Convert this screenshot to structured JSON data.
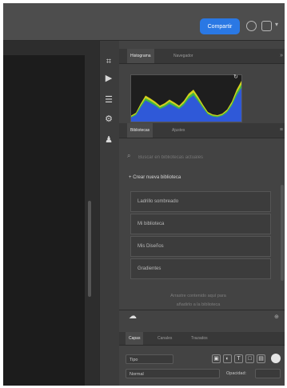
{
  "topbar": {
    "share_label": "Compartir"
  },
  "histogram_panel": {
    "tabs": [
      "Histograma",
      "Navegador"
    ],
    "collapse_glyph": "»",
    "icon": "refresh-icon",
    "levels": [
      0.05,
      0.12,
      0.35,
      0.55,
      0.48,
      0.4,
      0.3,
      0.36,
      0.45,
      0.38,
      0.3,
      0.42,
      0.6,
      0.7,
      0.52,
      0.32,
      0.14,
      0.08,
      0.06,
      0.1,
      0.2,
      0.4,
      0.7,
      0.92
    ]
  },
  "libraries_panel": {
    "tabs": [
      "Bibliotecas",
      "Ajustes"
    ],
    "menu_glyph": "≡",
    "search_placeholder": "Buscar en bibliotecas actuales",
    "section_title": "Crear nueva biblioteca",
    "items": [
      "Ladrillo sombreado",
      "Mi biblioteca",
      "Mis Diseños",
      "Gradientes"
    ],
    "hint_lines": [
      "Arrastre contenido aquí para",
      "añadirlo a la biblioteca"
    ]
  },
  "properties_panel": {
    "tabs": [
      "Capas",
      "Canales",
      "Trazados"
    ],
    "kind_filter": "Tipo",
    "blend_mode": "Normal",
    "opacity_label": "Opacidad:",
    "icons": [
      "image-filter-icon",
      "adjustment-filter-icon",
      "type-filter-icon",
      "shape-filter-icon",
      "smart-filter-icon"
    ]
  },
  "toolbar_icons": [
    "cursor-frame-icon",
    "play-icon",
    "adjust-icon",
    "brush-icon",
    "person-icon"
  ],
  "colors": {
    "accent": "#2a78e4",
    "histogram_yellow": "#e8e41c",
    "histogram_blue": "#2d4fe8",
    "histogram_green": "#2fb34a"
  }
}
